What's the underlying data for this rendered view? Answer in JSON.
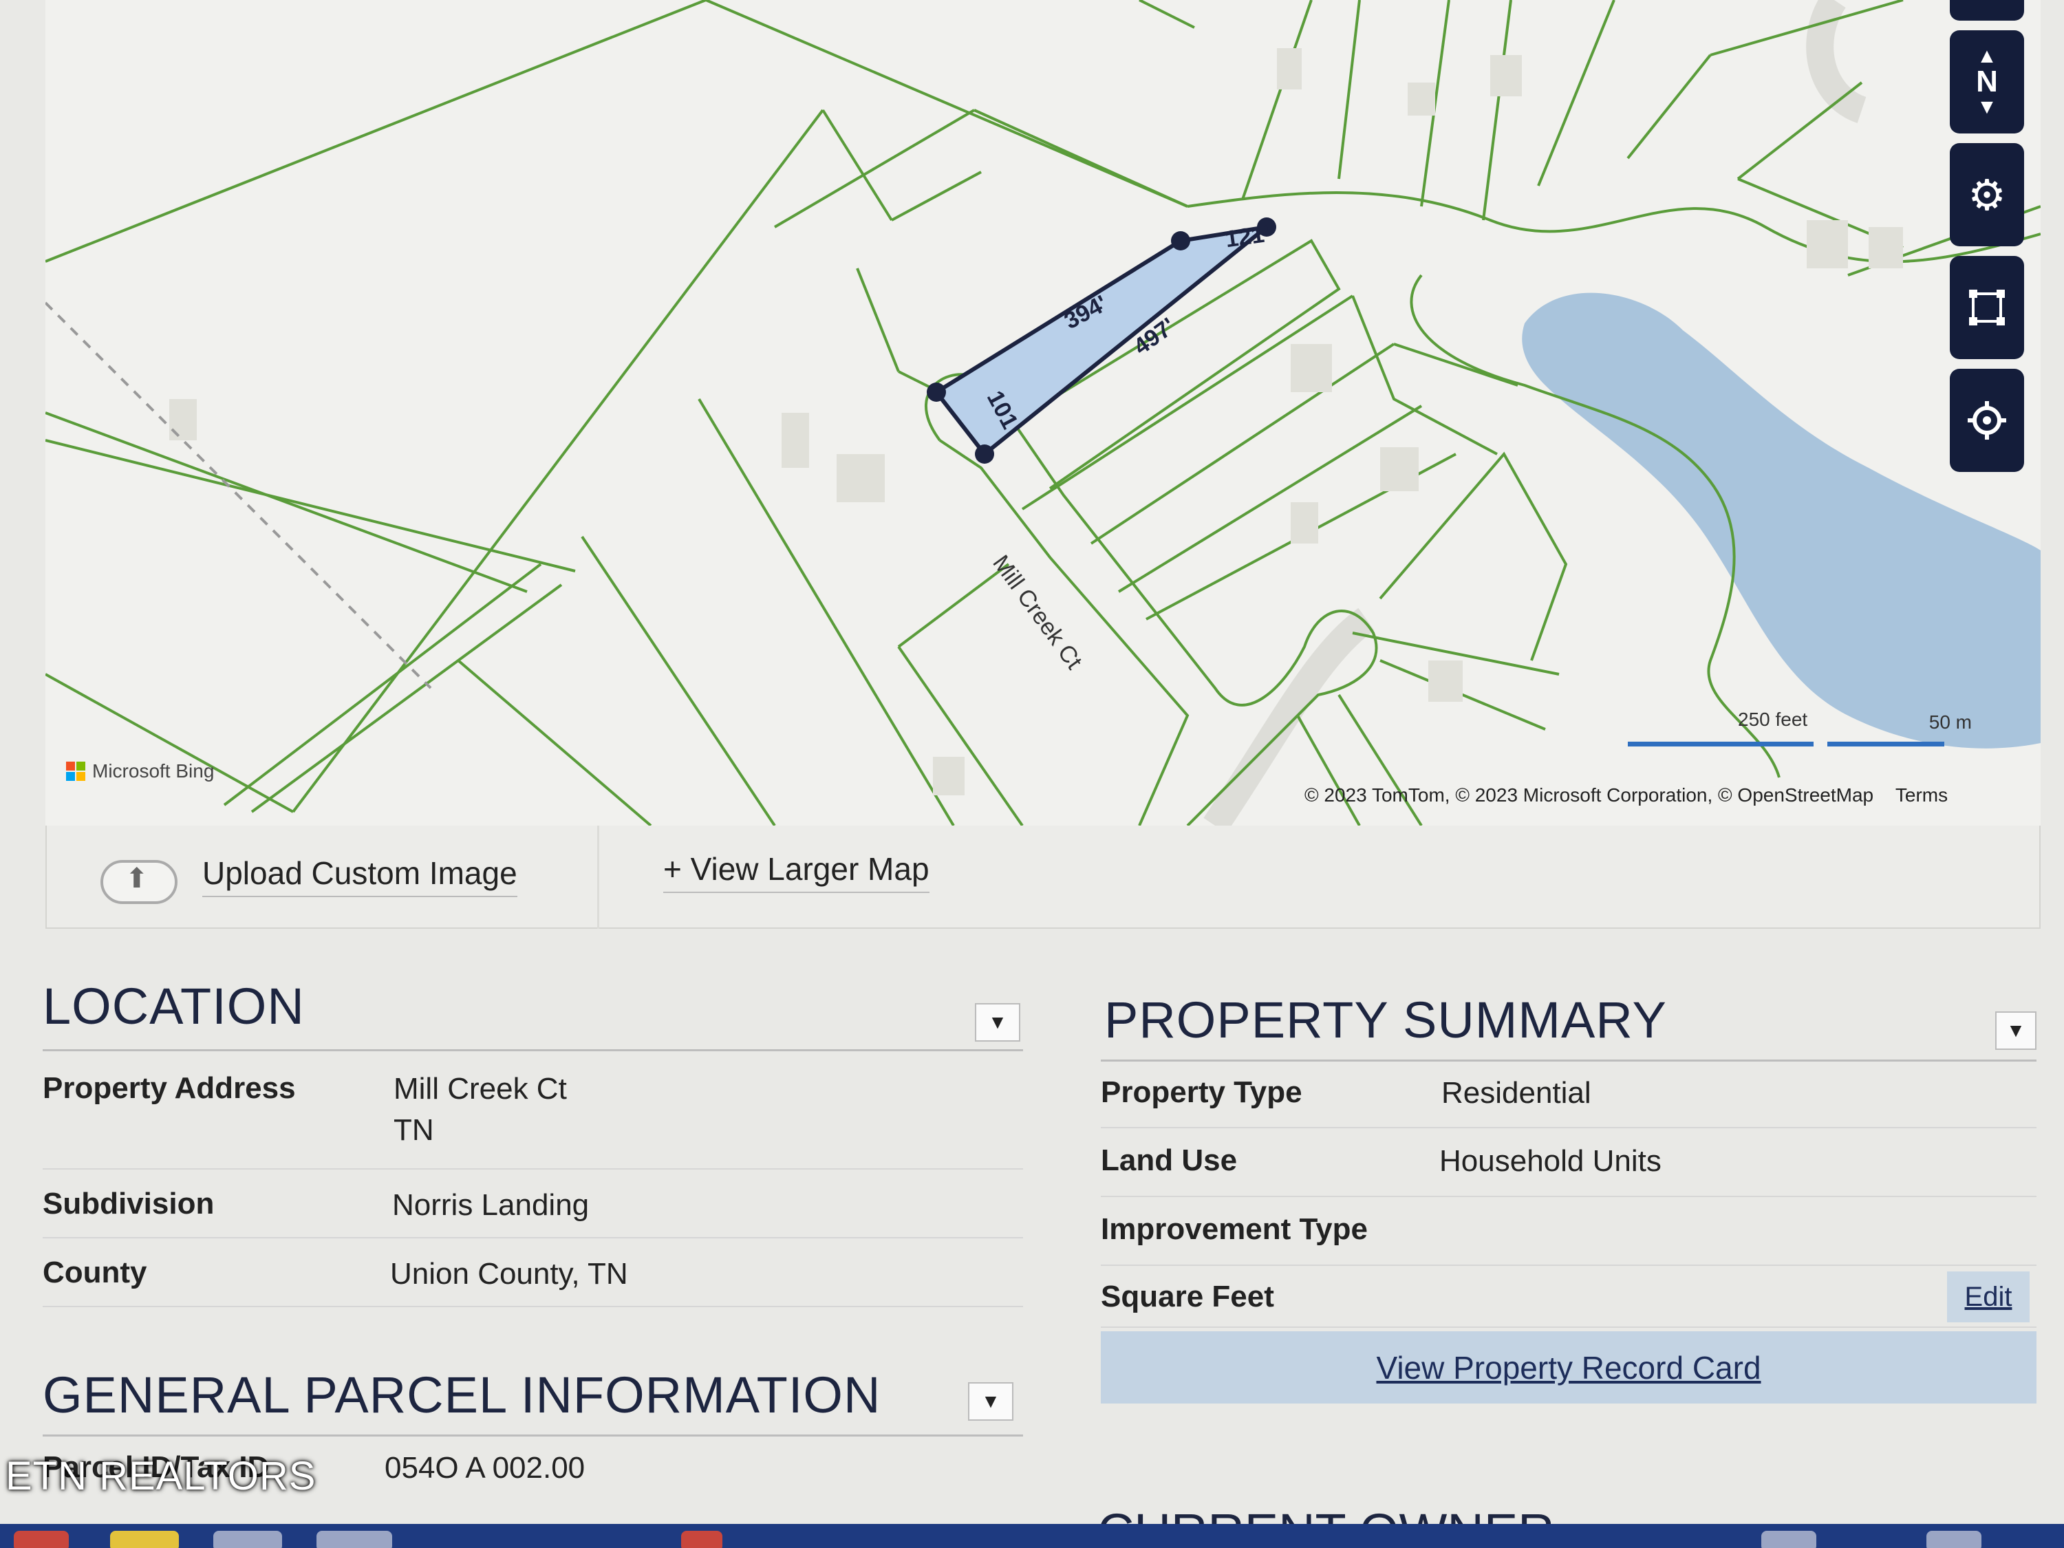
{
  "map": {
    "street_label": "Mill Creek Ct",
    "dimensions": {
      "top": "394'",
      "bottom": "497'",
      "right": "121'",
      "left": "101'"
    },
    "bing_label": "Microsoft Bing",
    "scale": {
      "feet": "250 feet",
      "meters": "50 m"
    },
    "attribution": "© 2023 TomTom, © 2023 Microsoft Corporation, © OpenStreetMap",
    "terms": "Terms",
    "controls": [
      {
        "name": "compass",
        "icon": "compass-icon",
        "label": "N"
      },
      {
        "name": "settings",
        "icon": "gear-icon"
      },
      {
        "name": "measure",
        "icon": "select-area-icon"
      },
      {
        "name": "locate",
        "icon": "crosshair-icon"
      }
    ],
    "colors": {
      "parcel_lines": "#5a9c3a",
      "water": "#a9c4dc",
      "selection": "#b9d0ea",
      "controls": "#141d3a"
    }
  },
  "toolbar": {
    "upload_label": "Upload Custom Image",
    "larger_map_label": "+ View Larger Map"
  },
  "location": {
    "title": "LOCATION",
    "rows": [
      {
        "label": "Property Address",
        "value": "Mill Creek Ct",
        "value2": "TN"
      },
      {
        "label": "Subdivision",
        "value": "Norris Landing"
      },
      {
        "label": "County",
        "value": "Union County, TN"
      }
    ]
  },
  "summary": {
    "title": "PROPERTY SUMMARY",
    "rows": [
      {
        "label": "Property Type",
        "value": "Residential"
      },
      {
        "label": "Land Use",
        "value": "Household Units"
      },
      {
        "label": "Improvement Type",
        "value": ""
      },
      {
        "label": "Square Feet",
        "value": "",
        "action": "Edit"
      }
    ],
    "record_card_label": "View Property Record Card"
  },
  "parcel": {
    "title": "GENERAL PARCEL INFORMATION",
    "rows": [
      {
        "label": "Parcel ID/Tax ID",
        "value": "054O A 002.00"
      }
    ]
  },
  "next_section_peek": "CURRENT OWNER",
  "watermark": "ETN REALTORS"
}
